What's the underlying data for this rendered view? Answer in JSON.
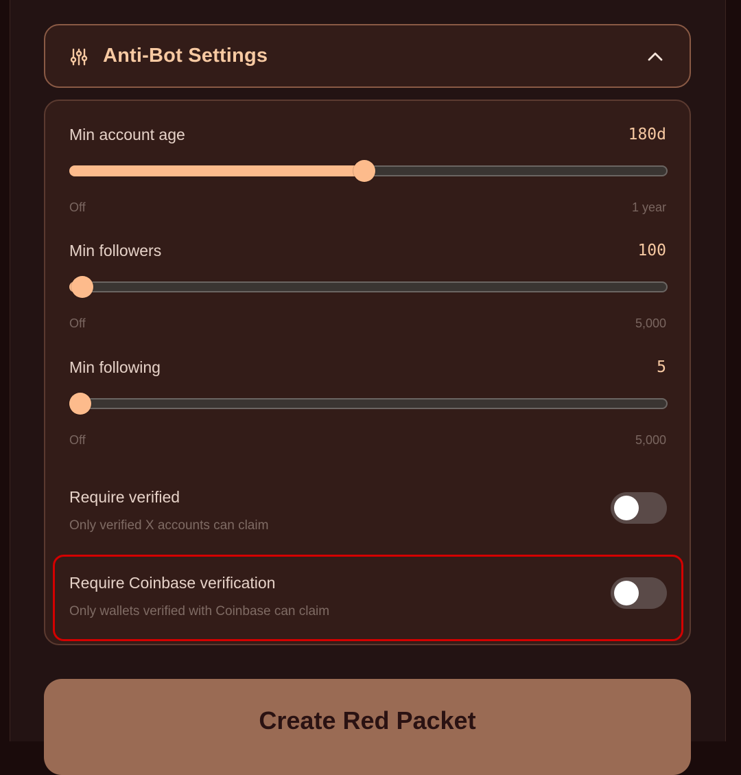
{
  "section": {
    "title": "Anti-Bot Settings",
    "icon": "sliders-icon",
    "collapse_icon": "chevron-up-icon"
  },
  "sliders": [
    {
      "label": "Min account age",
      "value": "180d",
      "min_label": "Off",
      "max_label": "1 year",
      "level": 0.493
    },
    {
      "label": "Min followers",
      "value": "100",
      "min_label": "Off",
      "max_label": "5,000",
      "level": 0.02
    },
    {
      "label": "Min following",
      "value": "5",
      "min_label": "Off",
      "max_label": "5,000",
      "level": 0.001
    }
  ],
  "toggles": [
    {
      "title": "Require verified",
      "subtitle": "Only verified X accounts can claim",
      "on": false
    },
    {
      "title": "Require Coinbase verification",
      "subtitle": "Only wallets verified with Coinbase can claim",
      "on": false
    }
  ],
  "cta": {
    "label": "Create Red Packet"
  },
  "colors": {
    "accent": "#fdbb8c",
    "highlight": "#d40000",
    "button": "#9a6b54"
  }
}
